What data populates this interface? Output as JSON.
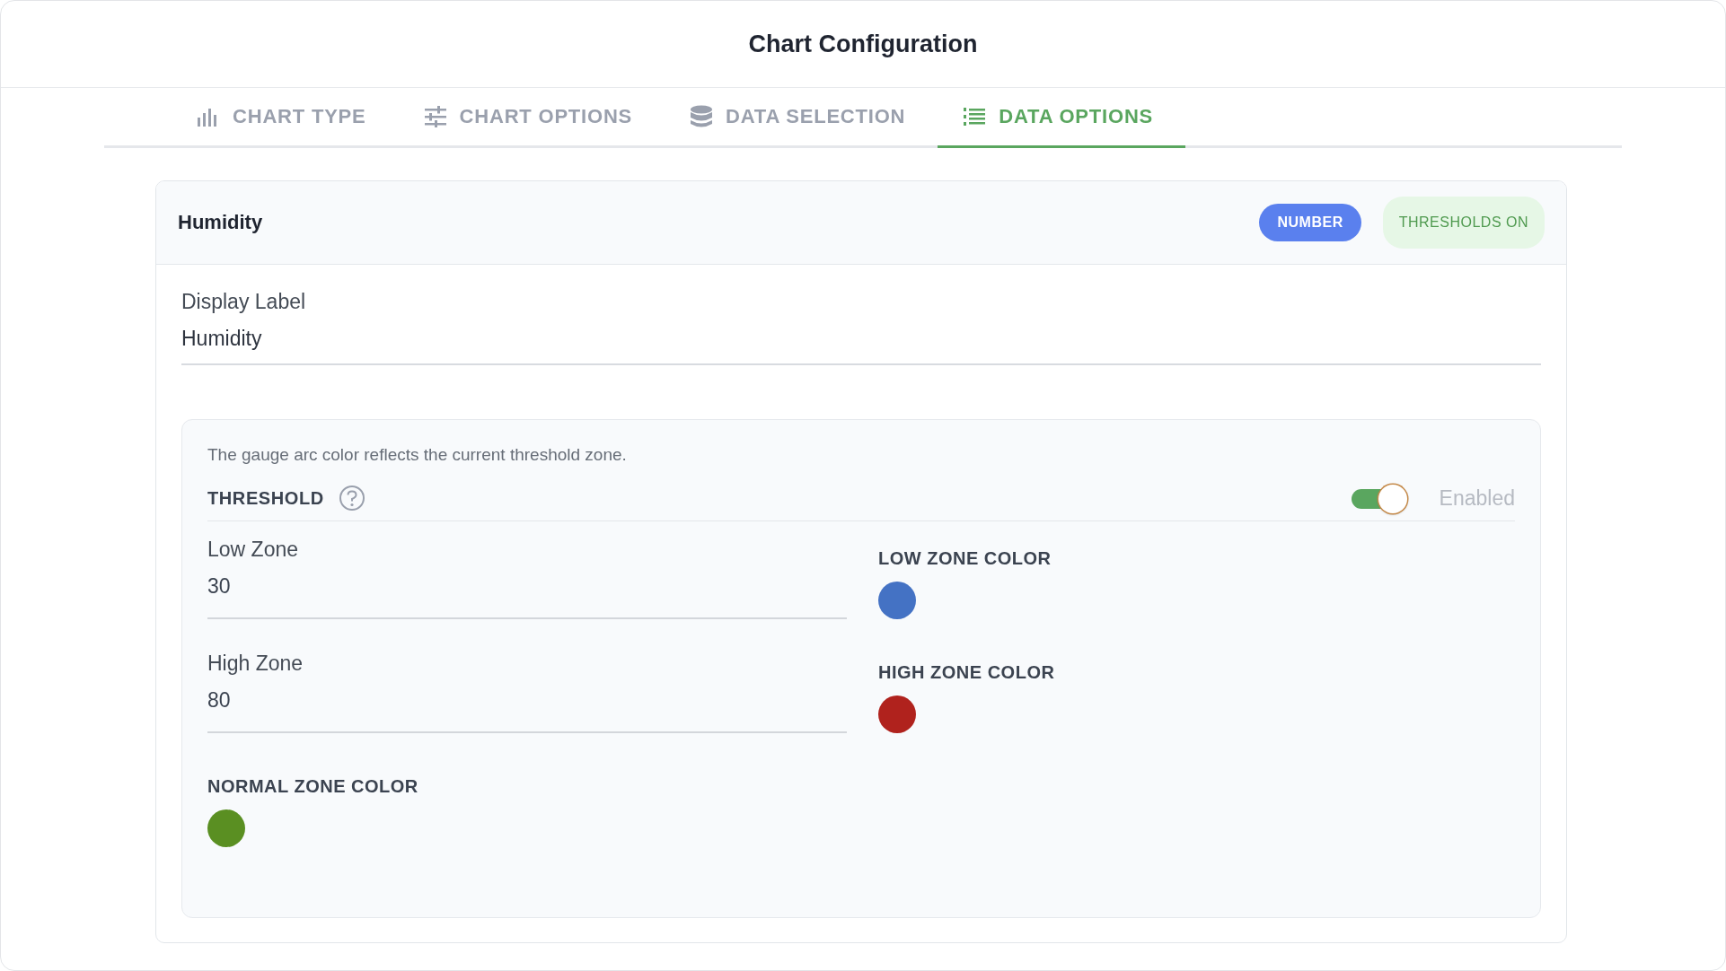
{
  "window": {
    "title": "Chart Configuration"
  },
  "tabs": [
    {
      "label": "CHART TYPE",
      "selected": false
    },
    {
      "label": "CHART OPTIONS",
      "selected": false
    },
    {
      "label": "DATA SELECTION",
      "selected": false
    },
    {
      "label": "DATA OPTIONS",
      "selected": true
    }
  ],
  "card": {
    "title": "Humidity",
    "badges": [
      {
        "label": "NUMBER",
        "kind": "type"
      },
      {
        "label": "THRESHOLDS ON",
        "kind": "status"
      }
    ],
    "display_label": {
      "label": "Display Label",
      "value": "Humidity"
    },
    "threshold": {
      "note": "The gauge arc color reflects the current threshold zone.",
      "title": "THRESHOLD",
      "enabled": true,
      "toggle_label": "Enabled",
      "items": [
        {
          "kind": "field",
          "label": "Low Zone",
          "value": "30"
        },
        {
          "kind": "color",
          "label": "LOW ZONE COLOR",
          "color": "#4472c4"
        },
        {
          "kind": "field",
          "label": "High Zone",
          "value": "80"
        },
        {
          "kind": "color",
          "label": "HIGH ZONE COLOR",
          "color": "#b0221d"
        },
        {
          "kind": "color",
          "label": "NORMAL ZONE COLOR",
          "color": "#5a8f22"
        }
      ]
    }
  }
}
